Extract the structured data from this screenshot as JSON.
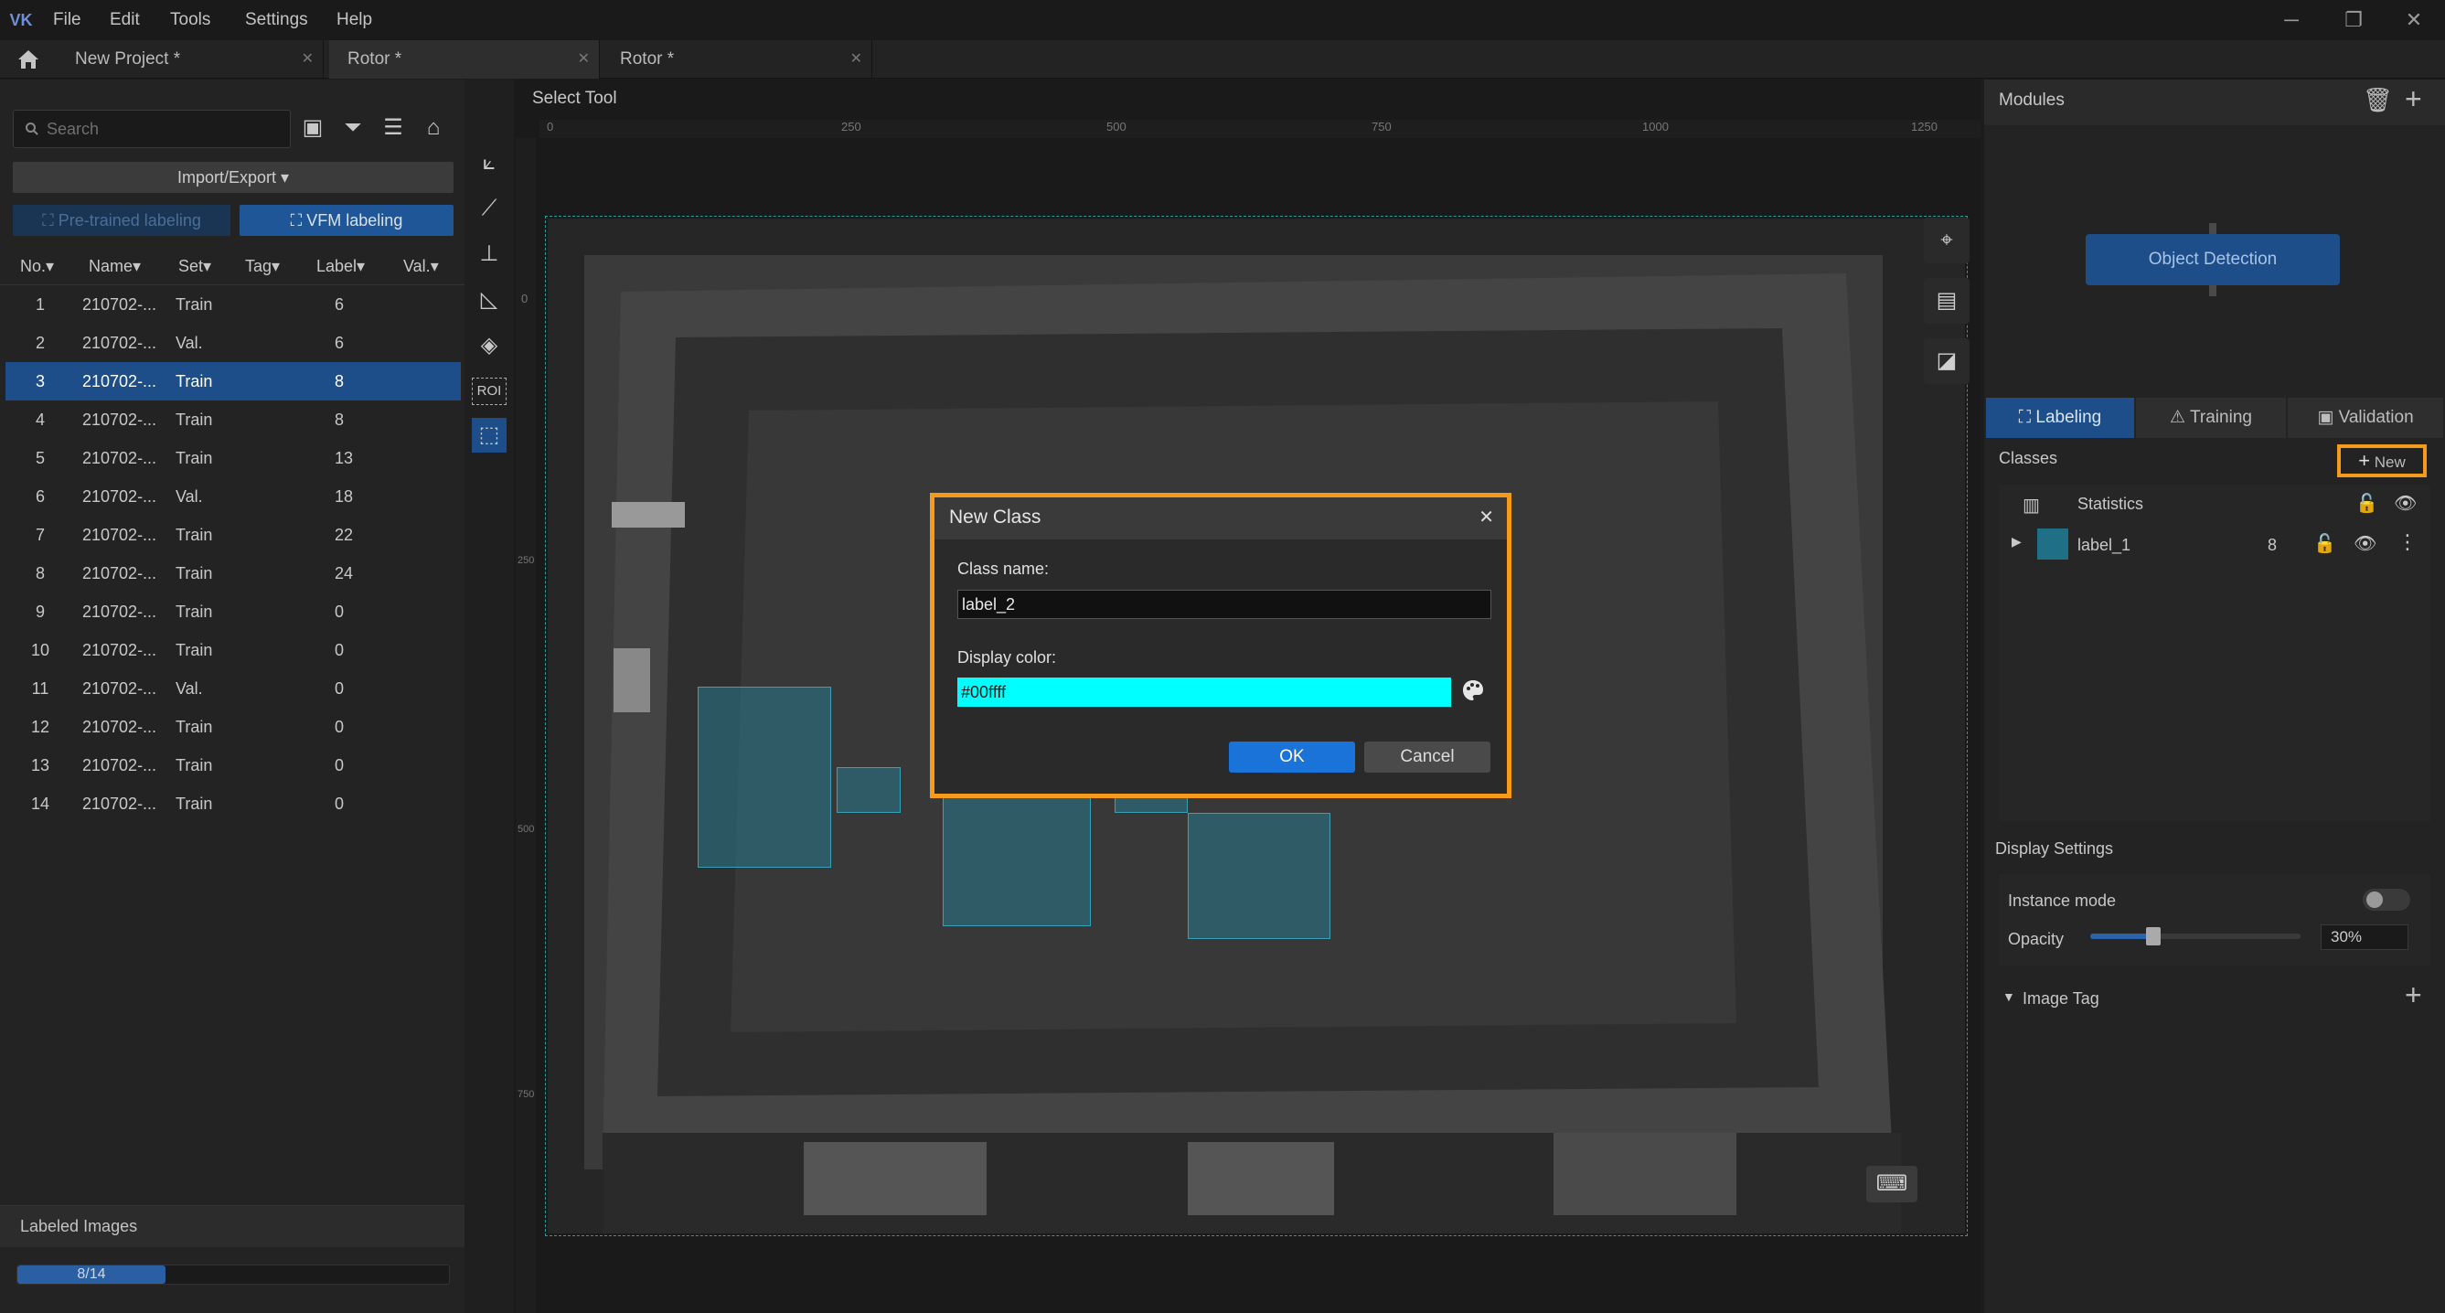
{
  "menubar": {
    "logo": "VK",
    "items": [
      "File",
      "Edit",
      "Tools",
      "Settings",
      "Help"
    ],
    "window_controls": [
      "─",
      "❐",
      "✕"
    ]
  },
  "tabs": [
    {
      "label": "New Project *"
    },
    {
      "label": "Rotor *"
    },
    {
      "label": "Rotor *"
    }
  ],
  "left": {
    "search_placeholder": "Search",
    "import_export": "Import/Export",
    "pretrained_btn": "Pre-trained labeling",
    "vfm_btn": "VFM labeling",
    "columns": [
      "No.",
      "Name",
      "Set",
      "Tag",
      "Label",
      "Val."
    ],
    "rows": [
      {
        "no": "1",
        "name": "210702-...",
        "set": "Train",
        "label": "6"
      },
      {
        "no": "2",
        "name": "210702-...",
        "set": "Val.",
        "label": "6"
      },
      {
        "no": "3",
        "name": "210702-...",
        "set": "Train",
        "label": "8"
      },
      {
        "no": "4",
        "name": "210702-...",
        "set": "Train",
        "label": "8"
      },
      {
        "no": "5",
        "name": "210702-...",
        "set": "Train",
        "label": "13"
      },
      {
        "no": "6",
        "name": "210702-...",
        "set": "Val.",
        "label": "18"
      },
      {
        "no": "7",
        "name": "210702-...",
        "set": "Train",
        "label": "22"
      },
      {
        "no": "8",
        "name": "210702-...",
        "set": "Train",
        "label": "24"
      },
      {
        "no": "9",
        "name": "210702-...",
        "set": "Train",
        "label": "0"
      },
      {
        "no": "10",
        "name": "210702-...",
        "set": "Train",
        "label": "0"
      },
      {
        "no": "11",
        "name": "210702-...",
        "set": "Val.",
        "label": "0"
      },
      {
        "no": "12",
        "name": "210702-...",
        "set": "Train",
        "label": "0"
      },
      {
        "no": "13",
        "name": "210702-...",
        "set": "Train",
        "label": "0"
      },
      {
        "no": "14",
        "name": "210702-...",
        "set": "Train",
        "label": "0"
      }
    ],
    "selected_row": 3,
    "labeled_title": "Labeled Images",
    "progress_text": "8/14",
    "progress_fraction": 0.343
  },
  "toolbar": {
    "tools": [
      "polygon-select-icon",
      "magic-wand-icon",
      "stamp-icon",
      "ruler-tool-icon",
      "eraser-icon",
      "roi-icon",
      "select-tool-icon"
    ],
    "roi_label": "ROI"
  },
  "canvas": {
    "title": "Select Tool",
    "h_ticks": [
      "0",
      "250",
      "500",
      "750",
      "1000",
      "1250"
    ],
    "v_ticks": [
      "0",
      "250",
      "500",
      "750"
    ]
  },
  "dialog": {
    "title": "New Class",
    "class_name_label": "Class name:",
    "class_name_value": "label_2",
    "display_color_label": "Display color:",
    "display_color_value": "#00ffff",
    "ok": "OK",
    "cancel": "Cancel",
    "close": "✕"
  },
  "right": {
    "modules_title": "Modules",
    "module_node": "Object Detection",
    "tabs": [
      "Labeling",
      "Training",
      "Validation"
    ],
    "classes_title": "Classes",
    "new_btn": "New",
    "statistics": "Statistics",
    "class_items": [
      {
        "name": "label_1",
        "count": "8",
        "color": "#1f6f86"
      }
    ],
    "display_settings": "Display Settings",
    "instance_mode": "Instance mode",
    "opacity_label": "Opacity",
    "opacity_value": "30%",
    "opacity_fraction": 0.3,
    "image_tag": "Image Tag"
  },
  "colors": {
    "accent": "#1d4e8a",
    "highlight": "#f59a1a",
    "button_blue": "#1a73d9"
  }
}
